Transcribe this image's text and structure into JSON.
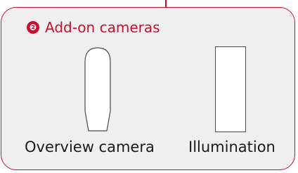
{
  "panel": {
    "badge": "❷",
    "title": "Add-on cameras",
    "accent_color": "#c8102e"
  },
  "devices": [
    {
      "label": "Overview camera",
      "shape": "tapered-rounded-tube"
    },
    {
      "label": "Illumination",
      "shape": "rectangle"
    }
  ]
}
